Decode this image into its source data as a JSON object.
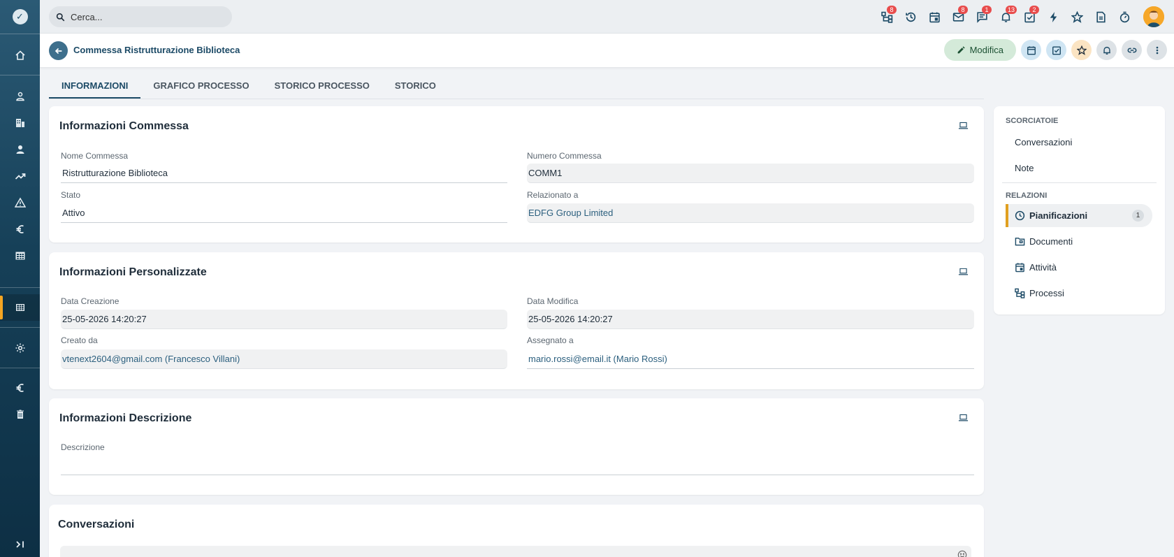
{
  "topbar": {
    "search_placeholder": "Cerca...",
    "icons": [
      {
        "name": "processes-icon",
        "badge": "8"
      },
      {
        "name": "history-icon",
        "badge": ""
      },
      {
        "name": "calendar-icon",
        "badge": ""
      },
      {
        "name": "mail-icon",
        "badge": "8"
      },
      {
        "name": "chat-icon",
        "badge": "1"
      },
      {
        "name": "bell-icon",
        "badge": "13"
      },
      {
        "name": "tasks-icon",
        "badge": "2"
      },
      {
        "name": "lightning-icon",
        "badge": ""
      },
      {
        "name": "star-icon",
        "badge": ""
      },
      {
        "name": "document-icon",
        "badge": ""
      },
      {
        "name": "timer-icon",
        "badge": ""
      }
    ]
  },
  "header": {
    "title": "Commessa Ristrutturazione Biblioteca",
    "edit_label": "Modifica"
  },
  "tabs": [
    "INFORMAZIONI",
    "GRAFICO PROCESSO",
    "STORICO PROCESSO",
    "STORICO"
  ],
  "info_commessa": {
    "title": "Informazioni Commessa",
    "fields": [
      {
        "label": "Nome Commessa",
        "value": "Ristrutturazione Biblioteca"
      },
      {
        "label": "Numero Commessa",
        "value": "COMM1"
      },
      {
        "label": "Stato",
        "value": "Attivo"
      },
      {
        "label": "Relazionato a",
        "value": "EDFG Group Limited"
      }
    ]
  },
  "info_personalizzate": {
    "title": "Informazioni Personalizzate",
    "fields": [
      {
        "label": "Data Creazione",
        "value": "25-05-2026 14:20:27"
      },
      {
        "label": "Data Modifica",
        "value": "25-05-2026 14:20:27"
      },
      {
        "label": "Creato da",
        "value": "vtenext2604@gmail.com (Francesco Villani)"
      },
      {
        "label": "Assegnato a",
        "value": "mario.rossi@email.it (Mario Rossi)"
      }
    ]
  },
  "info_descrizione": {
    "title": "Informazioni Descrizione",
    "fields": [
      {
        "label": "Descrizione",
        "value": ""
      }
    ]
  },
  "conversazioni": {
    "title": "Conversazioni"
  },
  "right_panel": {
    "shortcuts_title": "SCORCIATOIE",
    "shortcuts": [
      "Conversazioni",
      "Note"
    ],
    "relations_title": "RELAZIONI",
    "relations": [
      {
        "label": "Pianificazioni",
        "count": "1"
      },
      {
        "label": "Documenti",
        "count": ""
      },
      {
        "label": "Attività",
        "count": ""
      },
      {
        "label": "Processi",
        "count": ""
      }
    ]
  },
  "colors": {
    "accent": "#1c4a66",
    "active_marker": "#f4a522",
    "badge": "#e84c4c",
    "edit_button": "#d4ead9"
  }
}
